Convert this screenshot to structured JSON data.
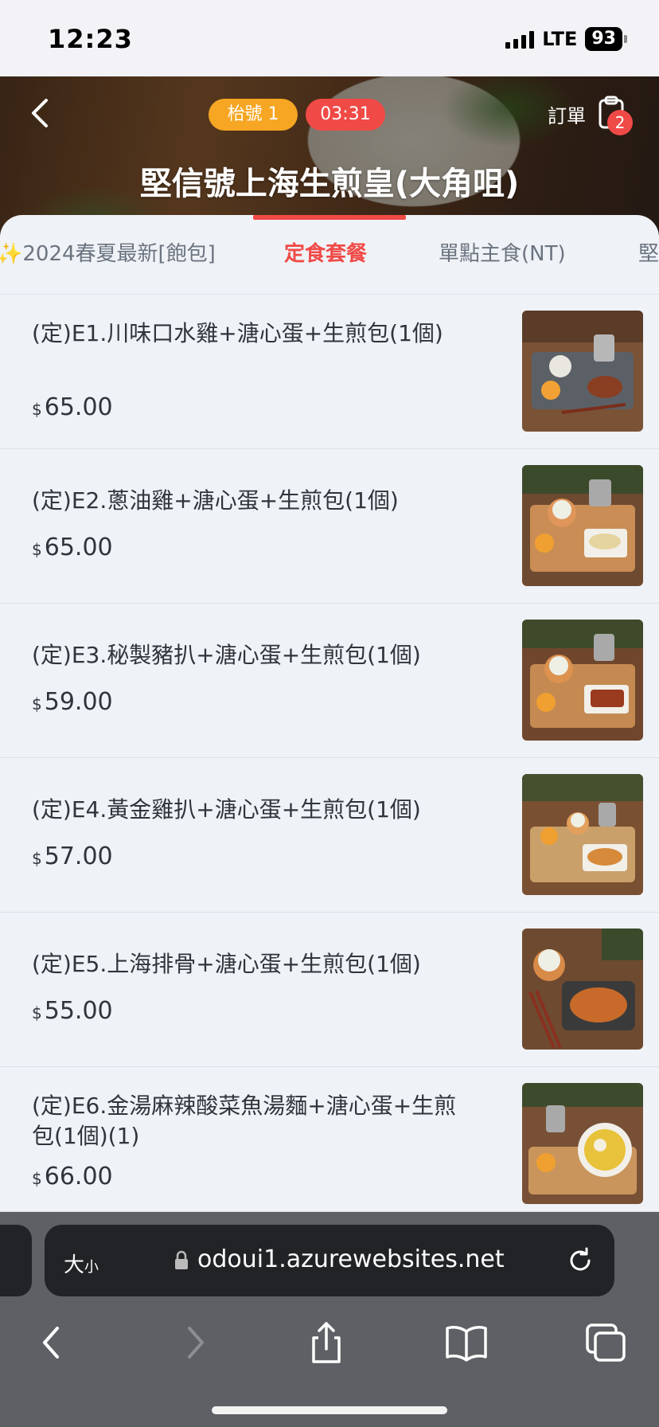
{
  "status_bar": {
    "time": "12:23",
    "network": "LTE",
    "battery": "93"
  },
  "header": {
    "table_label": "枱號 1",
    "timer": "03:31",
    "order_label": "訂單",
    "order_count": "2",
    "store_title": "堅信號上海生煎皇(大角咀)"
  },
  "tabs": [
    {
      "label": "✨2024春夏最新[飽包]",
      "active": false
    },
    {
      "label": "定食套餐",
      "active": true
    },
    {
      "label": "單點主食(NT)",
      "active": false
    },
    {
      "label": "堅",
      "active": false
    }
  ],
  "currency": "$",
  "menu": [
    {
      "name": "(定)E1.川味口水雞+溏心蛋+生煎包(1個)",
      "price": "65.00"
    },
    {
      "name": "(定)E2.蔥油雞+溏心蛋+生煎包(1個)",
      "price": "65.00"
    },
    {
      "name": "(定)E3.秘製豬扒+溏心蛋+生煎包(1個)",
      "price": "59.00"
    },
    {
      "name": "(定)E4.黃金雞扒+溏心蛋+生煎包(1個)",
      "price": "57.00"
    },
    {
      "name": "(定)E5.上海排骨+溏心蛋+生煎包(1個)",
      "price": "55.00"
    },
    {
      "name": "(定)E6.金湯麻辣酸菜魚湯麵+溏心蛋+生煎包(1個)(1)",
      "price": "66.00"
    }
  ],
  "browser": {
    "text_size": "大",
    "text_size_small": "小",
    "url": "odoui1.azurewebsites.net"
  },
  "colors": {
    "accent": "#f04a47",
    "table_pill": "#f6a623",
    "background": "#eff2f6"
  }
}
